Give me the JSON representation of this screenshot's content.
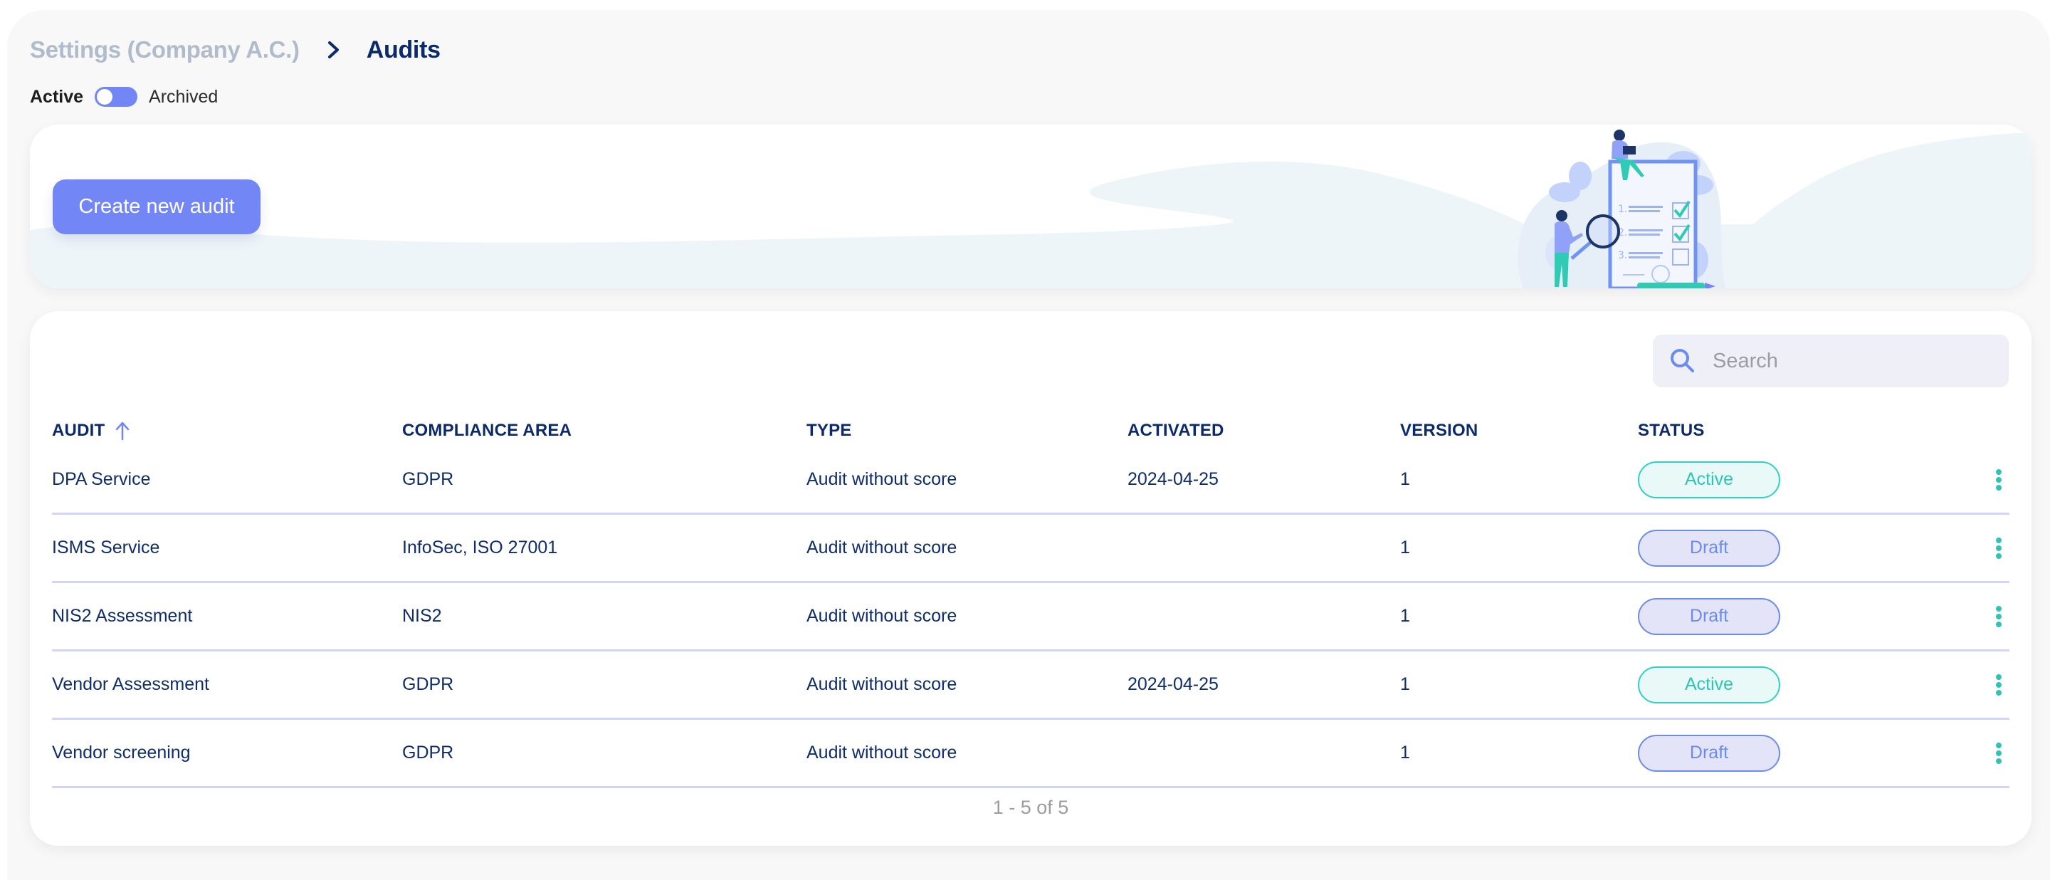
{
  "breadcrumb": {
    "parent": "Settings (Company A.C.)",
    "separator_icon": "chevron-right-icon",
    "current": "Audits"
  },
  "view_toggle": {
    "left_label": "Active",
    "right_label": "Archived",
    "selected": "Active"
  },
  "banner": {
    "create_button_label": "Create new audit",
    "illustration": "audit-checklist-illustration"
  },
  "search": {
    "icon": "search-icon",
    "placeholder": "Search",
    "value": ""
  },
  "table": {
    "sort": {
      "column": "AUDIT",
      "direction": "ascending"
    },
    "columns": [
      "AUDIT",
      "COMPLIANCE AREA",
      "TYPE",
      "ACTIVATED",
      "VERSION",
      "STATUS"
    ],
    "rows": [
      {
        "audit": "DPA Service",
        "area": "GDPR",
        "type": "Audit without score",
        "activated": "2024-04-25",
        "version": "1",
        "status": "Active"
      },
      {
        "audit": "ISMS Service",
        "area": "InfoSec, ISO 27001",
        "type": "Audit without score",
        "activated": "",
        "version": "1",
        "status": "Draft"
      },
      {
        "audit": "NIS2 Assessment",
        "area": "NIS2",
        "type": "Audit without score",
        "activated": "",
        "version": "1",
        "status": "Draft"
      },
      {
        "audit": "Vendor Assessment",
        "area": "GDPR",
        "type": "Audit without score",
        "activated": "2024-04-25",
        "version": "1",
        "status": "Active"
      },
      {
        "audit": "Vendor screening",
        "area": "GDPR",
        "type": "Audit without score",
        "activated": "",
        "version": "1",
        "status": "Draft"
      }
    ],
    "row_action_icon": "more-vertical-icon"
  },
  "pagination": {
    "text": "1 - 5 of 5"
  },
  "colors": {
    "accent": "#7386f5",
    "heading": "#0b2a6b",
    "breadcrumb_parent": "#b0bccb",
    "status_active": "#2fd1c0",
    "status_draft": "#6b8cec",
    "row_divider": "#d1d6f5",
    "kebab": "#2fc4b4"
  }
}
